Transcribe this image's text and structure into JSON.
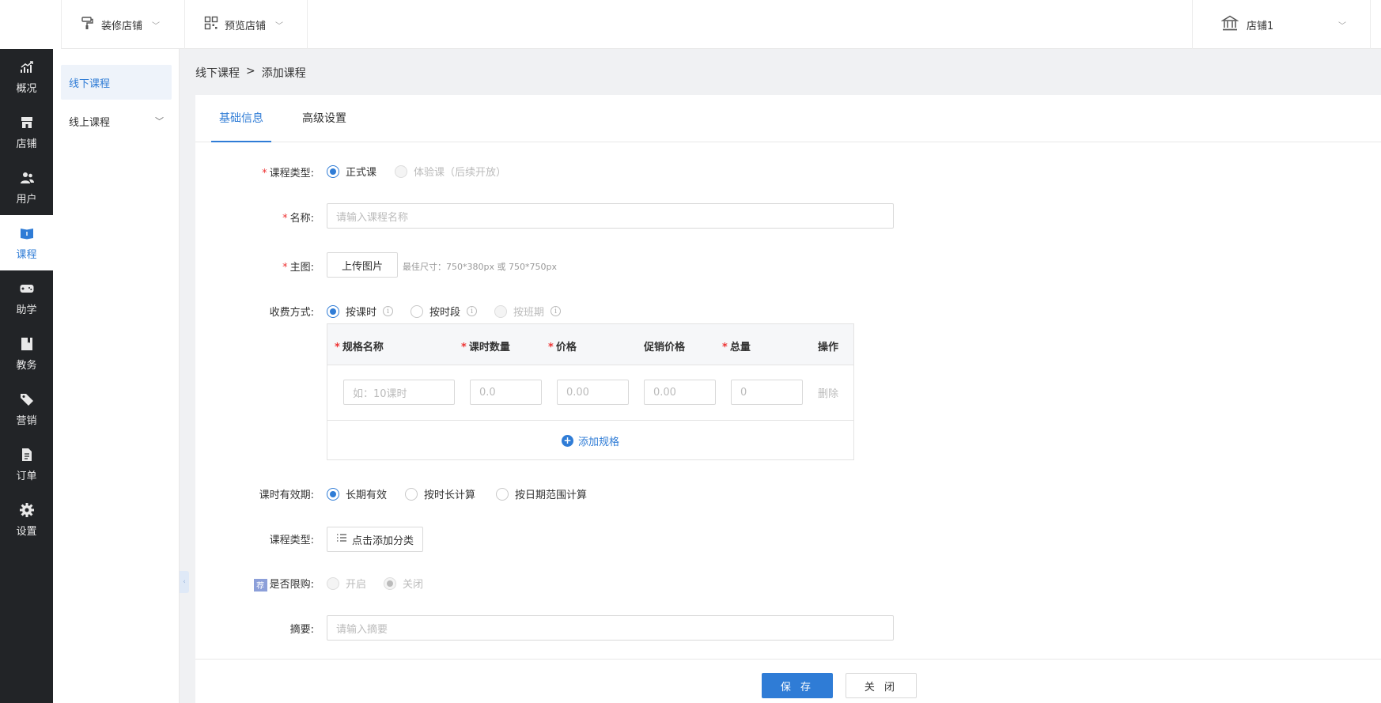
{
  "topbar": {
    "decorate_label": "装修店铺",
    "preview_label": "预览店铺",
    "store_label": "店铺1"
  },
  "nav": {
    "items": [
      {
        "label": "概况",
        "icon": "chart-icon"
      },
      {
        "label": "店铺",
        "icon": "store-icon"
      },
      {
        "label": "用户",
        "icon": "users-icon"
      },
      {
        "label": "课程",
        "icon": "book-icon"
      },
      {
        "label": "助学",
        "icon": "gamepad-icon"
      },
      {
        "label": "教务",
        "icon": "notebook-icon"
      },
      {
        "label": "营销",
        "icon": "tag-icon"
      },
      {
        "label": "订单",
        "icon": "document-icon"
      },
      {
        "label": "设置",
        "icon": "gear-icon"
      }
    ],
    "active": "课程"
  },
  "subnav": {
    "items": [
      {
        "label": "线下课程"
      },
      {
        "label": "线上课程"
      }
    ]
  },
  "breadcrumb": {
    "parent": "线下课程",
    "separator": ">",
    "current": "添加课程"
  },
  "tabs": [
    {
      "label": "基础信息"
    },
    {
      "label": "高级设置"
    }
  ],
  "form": {
    "course_type": {
      "label": "课程类型:",
      "options": [
        "正式课",
        "体验课（后续开放）"
      ],
      "selected": "正式课"
    },
    "name": {
      "label": "名称:",
      "placeholder": "请输入课程名称"
    },
    "main_image": {
      "label": "主图:",
      "button": "上传图片",
      "hint": "最佳尺寸：750*380px 或 750*750px"
    },
    "charge": {
      "label": "收费方式:",
      "options": [
        "按课时",
        "按时段",
        "按班期"
      ],
      "selected": "按课时"
    },
    "spec_table": {
      "headers": [
        "规格名称",
        "课时数量",
        "价格",
        "促销价格",
        "总量",
        "操作"
      ],
      "required": [
        true,
        true,
        true,
        false,
        true,
        false
      ],
      "row_placeholders": [
        "如：10课时",
        "0.0",
        "0.00",
        "0.00",
        "0"
      ],
      "delete_label": "删除",
      "add_label": "添加规格"
    },
    "validity": {
      "label": "课时有效期:",
      "options": [
        "长期有效",
        "按时长计算",
        "按日期范围计算"
      ],
      "selected": "长期有效"
    },
    "category": {
      "label": "课程类型:",
      "button": "点击添加分类"
    },
    "purchase_limit": {
      "badge": "荐",
      "label": "是否限购:",
      "options": [
        "开启",
        "关闭"
      ],
      "selected": "关闭"
    },
    "summary": {
      "label": "摘要:",
      "placeholder": "请输入摘要"
    }
  },
  "footer": {
    "save": "保 存",
    "close": "关 闭"
  },
  "colors": {
    "accent": "#2f7cd6",
    "sidebar_bg": "#222427",
    "required": "#e33333"
  }
}
